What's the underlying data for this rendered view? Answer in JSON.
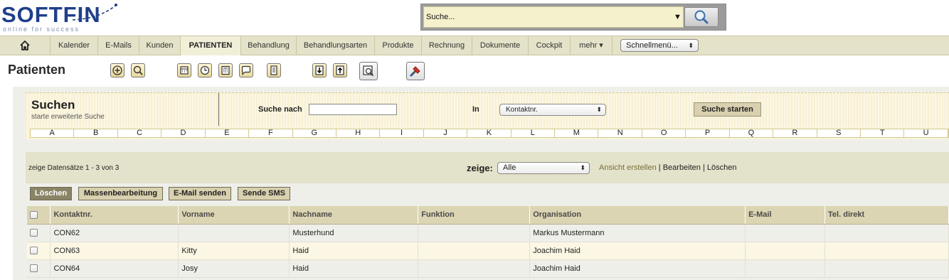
{
  "logo": {
    "name": "SOFTFIN",
    "tagline": "online for success"
  },
  "top_search": {
    "placeholder": "Suche...",
    "arrow": "▼",
    "button_icon": "magnifier-icon"
  },
  "nav": {
    "home_icon": "home-icon",
    "items": [
      "Kalender",
      "E-Mails",
      "Kunden",
      "PATIENTEN",
      "Behandlung",
      "Behandlungsarten",
      "Produkte",
      "Rechnung",
      "Dokumente",
      "Cockpit",
      "mehr ▾"
    ],
    "active": "PATIENTEN",
    "schnellmenu": "Schnellmenü...",
    "schnellmenu_arrow": "⬍"
  },
  "page": {
    "title": "Patienten"
  },
  "toolbar": {
    "icons": [
      "add-icon",
      "search-icon",
      "calendar-icon",
      "clock-icon",
      "calculator-icon",
      "comment-icon",
      "document-icon",
      "import-icon",
      "export-icon",
      "print-preview-icon",
      "tools-icon"
    ]
  },
  "search_panel": {
    "title": "Suchen",
    "subtitle": "starte erweiterte Suche",
    "search_for_label": "Suche nach",
    "search_for_value": "",
    "in_label": "In",
    "in_value": "Kontaktnr.",
    "in_arrow": "⬍",
    "start_button": "Suche starten",
    "letters": [
      "A",
      "B",
      "C",
      "D",
      "E",
      "F",
      "G",
      "H",
      "I",
      "J",
      "K",
      "L",
      "M",
      "N",
      "O",
      "P",
      "Q",
      "R",
      "S",
      "T",
      "U"
    ]
  },
  "records": {
    "count_text": "zeige Datensätze 1 - 3 von 3",
    "zeige_label": "zeige:",
    "zeige_value": "Alle",
    "zeige_arrow": "⬍",
    "link_ansicht": "Ansicht erstellen",
    "sep": "|",
    "link_bearbeiten": "Bearbeiten",
    "link_loeschen": "Löschen"
  },
  "actions": {
    "delete": "Löschen",
    "bulk_edit": "Massenbearbeitung",
    "send_email": "E-Mail senden",
    "send_sms": "Sende SMS"
  },
  "table": {
    "headers": [
      "Kontaktnr.",
      "Vorname",
      "Nachname",
      "Funktion",
      "Organisation",
      "E-Mail",
      "Tel. direkt"
    ],
    "rows": [
      {
        "kontaktnr": "CON62",
        "vorname": "",
        "nachname": "Musterhund",
        "funktion": "",
        "organisation": "Markus Mustermann",
        "email": "",
        "tel": ""
      },
      {
        "kontaktnr": "CON63",
        "vorname": "Kitty",
        "nachname": "Haid",
        "funktion": "",
        "organisation": "Joachim Haid",
        "email": "",
        "tel": ""
      },
      {
        "kontaktnr": "CON64",
        "vorname": "Josy",
        "nachname": "Haid",
        "funktion": "",
        "organisation": "Joachim Haid",
        "email": "",
        "tel": ""
      }
    ]
  },
  "colors": {
    "brand": "#1f3f8a",
    "nav_bg": "#e4e2c8",
    "panel_bg": "#f8f0d2",
    "header_bg": "#dcd5b3",
    "button_bg": "#d8d0ae"
  }
}
